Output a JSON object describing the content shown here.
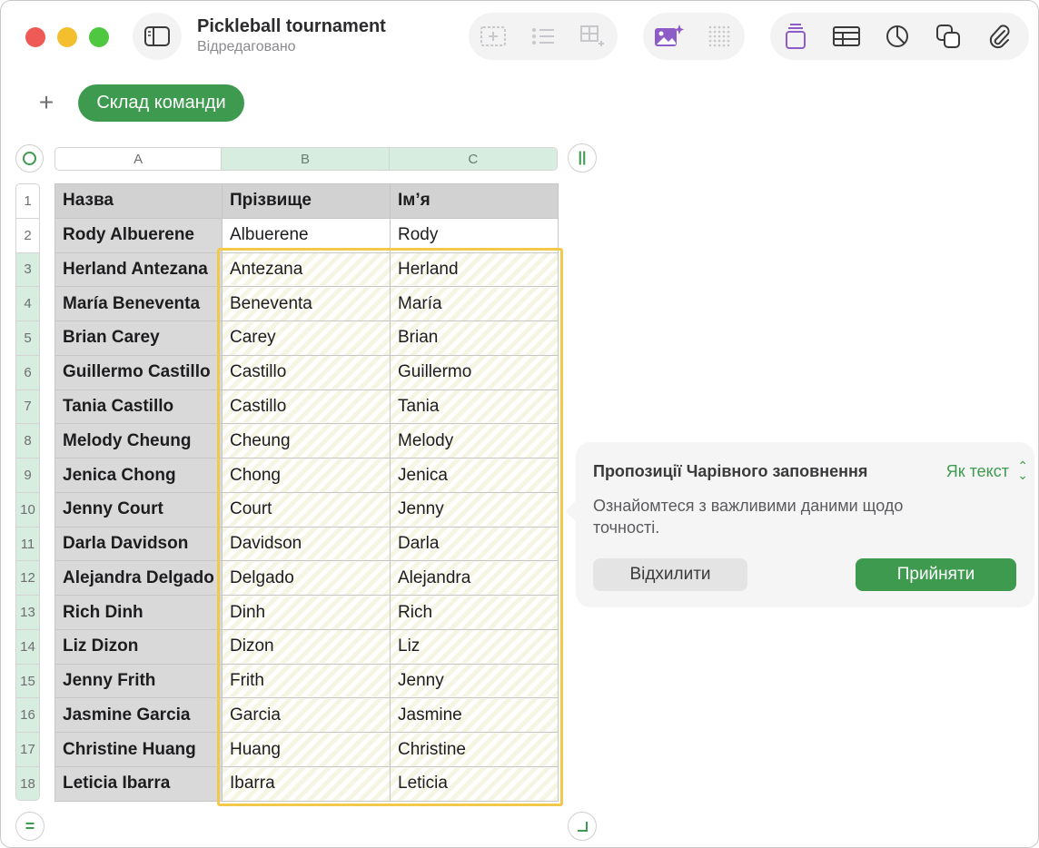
{
  "window": {
    "title": "Pickleball tournament",
    "subtitle": "Відредаговано"
  },
  "toolbar": {
    "icons": [
      "sidebar-icon",
      "insert-text-box-icon",
      "list-icon",
      "add-table-row-icon",
      "image-playground-icon",
      "dot-grid-icon",
      "format-icon",
      "table-icon",
      "chart-icon",
      "shapes-icon",
      "attachment-icon"
    ],
    "accent_color": "#8e5cc7"
  },
  "sheets": {
    "add_label": "+",
    "active_tab": "Склад команди"
  },
  "table": {
    "columns": [
      "A",
      "B",
      "C"
    ],
    "row_numbers": [
      "1",
      "2",
      "3",
      "4",
      "5",
      "6",
      "7",
      "8",
      "9",
      "10",
      "11",
      "12",
      "13",
      "14",
      "15",
      "16",
      "17",
      "18"
    ],
    "header": [
      "Назва",
      "Прізвище",
      "Ім’я"
    ],
    "rows": [
      [
        "Rody Albuerene",
        "Albuerene",
        "Rody"
      ],
      [
        "Herland Antezana",
        "Antezana",
        "Herland"
      ],
      [
        "María Beneventa",
        "Beneventa",
        "María"
      ],
      [
        "Brian Carey",
        "Carey",
        "Brian"
      ],
      [
        "Guillermo Castillo",
        "Castillo",
        "Guillermo"
      ],
      [
        "Tania Castillo",
        "Castillo",
        "Tania"
      ],
      [
        "Melody Cheung",
        "Cheung",
        "Melody"
      ],
      [
        "Jenica Chong",
        "Chong",
        "Jenica"
      ],
      [
        "Jenny Court",
        "Court",
        "Jenny"
      ],
      [
        "Darla Davidson",
        "Davidson",
        "Darla"
      ],
      [
        "Alejandra Delgado",
        "Delgado",
        "Alejandra"
      ],
      [
        "Rich Dinh",
        "Dinh",
        "Rich"
      ],
      [
        "Liz Dizon",
        "Dizon",
        "Liz"
      ],
      [
        "Jenny Frith",
        "Frith",
        "Jenny"
      ],
      [
        "Jasmine Garcia",
        "Garcia",
        "Jasmine"
      ],
      [
        "Christine Huang",
        "Huang",
        "Christine"
      ],
      [
        "Leticia Ibarra",
        "Ibarra",
        "Leticia"
      ]
    ]
  },
  "magic_fill": {
    "title": "Пропозиції Чарівного заповнення",
    "mode": "Як текст",
    "body": "Ознайомтеся з важливими даними щодо точності.",
    "reject_label": "Відхилити",
    "accept_label": "Прийняти",
    "accent_color": "#3d9a4e",
    "highlight_color": "#f2c94c"
  }
}
